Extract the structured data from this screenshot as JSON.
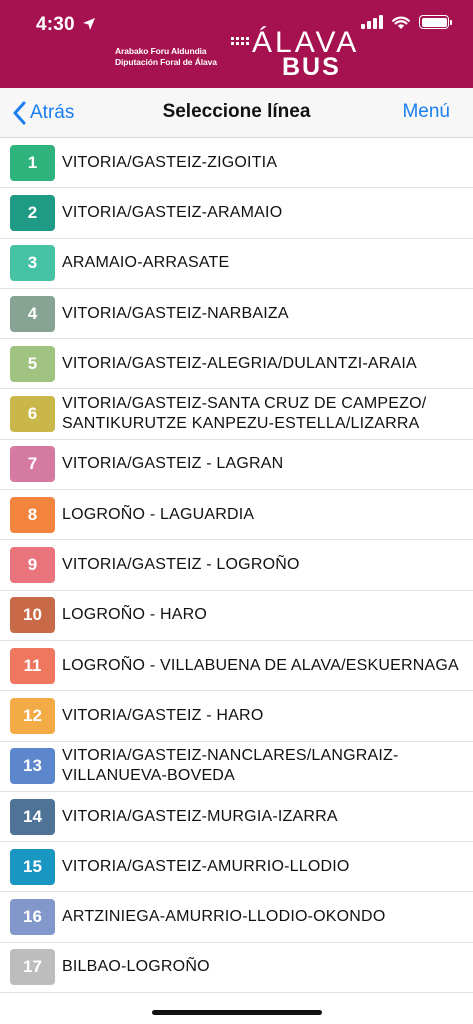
{
  "status_bar": {
    "time": "4:30"
  },
  "logo": {
    "line1": "Arabako Foru Aldundia",
    "line2": "Diputación Foral de Álava",
    "word1": "ÁLAVA",
    "word2": "BUS"
  },
  "nav": {
    "back_label": "Atrás",
    "title": "Seleccione línea",
    "menu_label": "Menú"
  },
  "colors": {
    "header": "#a6124f",
    "link": "#1a7ef0"
  },
  "lines": [
    {
      "number": "1",
      "name": "VITORIA/GASTEIZ-ZIGOITIA",
      "color": "#2fb37c"
    },
    {
      "number": "2",
      "name": "VITORIA/GASTEIZ-ARAMAIO",
      "color": "#1f9a85"
    },
    {
      "number": "3",
      "name": "ARAMAIO-ARRASATE",
      "color": "#46c2a4"
    },
    {
      "number": "4",
      "name": "VITORIA/GASTEIZ-NARBAIZA",
      "color": "#86a394"
    },
    {
      "number": "5",
      "name": "VITORIA/GASTEIZ-ALEGRIA/DULANTZI-ARAIA",
      "color": "#a1c381"
    },
    {
      "number": "6",
      "name": "VITORIA/GASTEIZ-SANTA CRUZ DE CAMPEZO/ SANTIKURUTZE KANPEZU-ESTELLA/LIZARRA",
      "color": "#c9b74a"
    },
    {
      "number": "7",
      "name": "VITORIA/GASTEIZ - LAGRAN",
      "color": "#d57aa1"
    },
    {
      "number": "8",
      "name": "LOGROÑO - LAGUARDIA",
      "color": "#f2843d"
    },
    {
      "number": "9",
      "name": "VITORIA/GASTEIZ - LOGROÑO",
      "color": "#e9747c"
    },
    {
      "number": "10",
      "name": "LOGROÑO - HARO",
      "color": "#c86a48"
    },
    {
      "number": "11",
      "name": "LOGROÑO - VILLABUENA DE ALAVA/ESKUERNAGA",
      "color": "#ef775f"
    },
    {
      "number": "12",
      "name": "VITORIA/GASTEIZ - HARO",
      "color": "#f3ab46"
    },
    {
      "number": "13",
      "name": "VITORIA/GASTEIZ-NANCLARES/LANGRAIZ-VILLANUEVA-BOVEDA",
      "color": "#5d87cc"
    },
    {
      "number": "14",
      "name": "VITORIA/GASTEIZ-MURGIA-IZARRA",
      "color": "#4f7396"
    },
    {
      "number": "15",
      "name": "VITORIA/GASTEIZ-AMURRIO-LLODIO",
      "color": "#1a96c2"
    },
    {
      "number": "16",
      "name": "ARTZINIEGA-AMURRIO-LLODIO-OKONDO",
      "color": "#8398ca"
    },
    {
      "number": "17",
      "name": "BILBAO-LOGROÑO",
      "color": "#bdbdbd"
    }
  ]
}
